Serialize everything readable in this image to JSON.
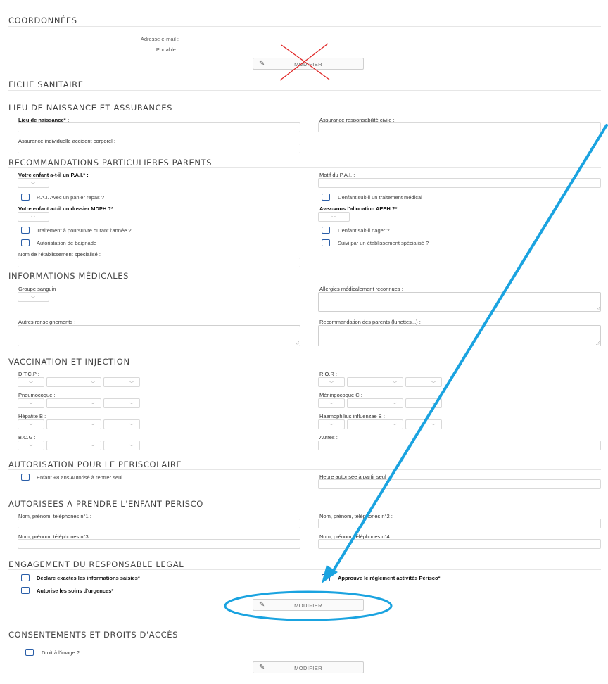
{
  "coordonnees": {
    "title": "COORDONNÉES",
    "email_label": "Adresse e-mail  :",
    "phone_label": "Portable  :",
    "modify_label": "MODIFIER"
  },
  "fiche": {
    "title": "FICHE SANITAIRE"
  },
  "lieu": {
    "title": "LIEU DE NAISSANCE ET ASSURANCES",
    "birthplace_label": "Lieu de naissance* :",
    "rc_label": "Assurance responsabilité civile :",
    "accident_label": "Assurance individuelle accident corporel :"
  },
  "recommandations": {
    "title": "RECOMMANDATIONS PARTICULIERES PARENTS",
    "pai_label": "Votre enfant a-t-il un P.A.I.* :",
    "pai_motif_label": "Motif du P.A.I. :",
    "panier_label": "P.A.I. Avec un panier repas ?",
    "traitement_medical_label": "L'enfant suit-il un traitement médical",
    "mdph_label": "Votre enfant a-t-il un dossier MDPH ?* :",
    "aeeh_label": "Avez-vous l'allocation AEEH ?* :",
    "traitement_annee_label": "Traitement à poursuivre durant l'année ?",
    "nager_label": "L'enfant sait-il nager ?",
    "baignade_label": "Autoristation de baignade",
    "suivi_label": "Suivi par un établissement spécialisé ?",
    "etab_label": "Nom de l'établissement spécialisé :"
  },
  "medical": {
    "title": "INFORMATIONS MÉDICALES",
    "groupe_label": "Groupe sanguin :",
    "allergies_label": "Allergies médicalement reconnues :",
    "autres_label": "Autres renseignements :",
    "reco_label": "Recommandation des parents (lunettes...) :"
  },
  "vaccination": {
    "title": "VACCINATION ET INJECTION",
    "dtcp_label": "D.T.C.P :",
    "ror_label": "R.O.R :",
    "pneumo_label": "Pneumocoque :",
    "mening_label": "Méningocoque C :",
    "hepatite_label": "Hépatite B :",
    "haemo_label": "Haemophilius influenzae B :",
    "bcg_label": "B.C.G :",
    "autres_label": "Autres :"
  },
  "periscolaire": {
    "title": "AUTORISATION POUR LE PERISCOLAIRE",
    "rentrer_label": "Enfant +8 ans Autorisé à rentrer seul",
    "heure_label": "Heure autorisée à partir seul :"
  },
  "autorisees": {
    "title": "AUTORISEES A PRENDRE L'ENFANT PERISCO",
    "n1_label": "Nom, prénom, téléphones n°1 :",
    "n2_label": "Nom, prénom, téléphones n°2 :",
    "n3_label": "Nom, prénom, téléphones n°3 :",
    "n4_label": "Nom, prénom, téléphones n°4 :"
  },
  "engagement": {
    "title": "ENGAGEMENT DU RESPONSABLE LEGAL",
    "declare_label": "Déclare exactes les informations saisies*",
    "approuve_label": "Approuve le règlement activités Périsco*",
    "soins_label": "Autorise les soins d'urgences*",
    "modify_label": "MODIFIER"
  },
  "consentements": {
    "title": "CONSENTEMENTS ET DROITS D'ACCÈS",
    "image_label": "Droit à l'image ?",
    "modify_label": "MODIFIER"
  },
  "annotations": {
    "arrow_color": "#1aa3e0",
    "cross_color": "#e02424"
  }
}
